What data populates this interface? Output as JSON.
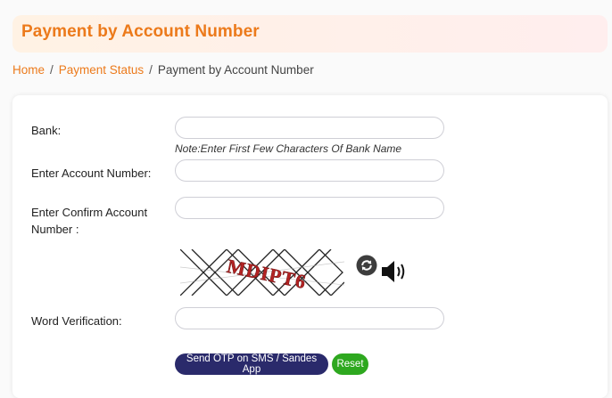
{
  "header": {
    "title": "Payment by Account Number"
  },
  "breadcrumb": {
    "home": "Home",
    "separator": "/",
    "payment_status": "Payment Status",
    "current": "Payment by Account Number"
  },
  "form": {
    "bank_label": "Bank:",
    "bank_value": "",
    "bank_note": "Note:Enter First Few Characters Of Bank Name",
    "account_label": "Enter Account Number:",
    "account_value": "",
    "confirm_label_line1": "Enter Confirm Account",
    "confirm_label_line2": "Number :",
    "confirm_value": "",
    "captcha_text": "MDIPT6",
    "word_verification_label": "Word Verification:",
    "word_verification_value": ""
  },
  "buttons": {
    "send_otp": "Send OTP on SMS / Sandes App",
    "reset": "Reset"
  },
  "icons": {
    "refresh": "refresh-icon",
    "audio": "speaker-icon"
  },
  "colors": {
    "accent": "#ec7a1b",
    "primary_button": "#2a2a6b",
    "reset_button": "#2ea81f"
  }
}
